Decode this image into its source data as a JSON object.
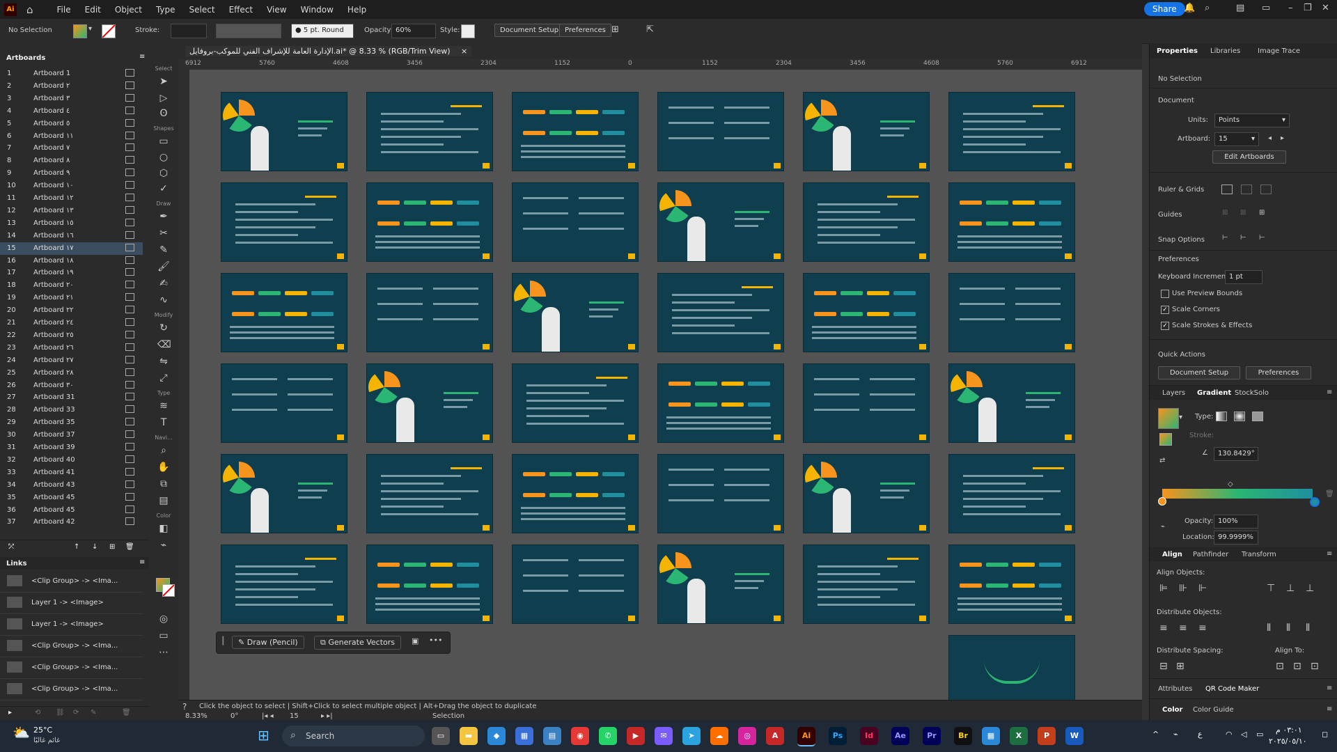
{
  "app": {
    "logo": "Ai",
    "menu": [
      "File",
      "Edit",
      "Object",
      "Type",
      "Select",
      "Effect",
      "View",
      "Window",
      "Help"
    ],
    "share_label": "Share"
  },
  "control_bar": {
    "selection": "No Selection",
    "stroke_label": "Stroke:",
    "brush": "5 pt. Round",
    "opacity_label": "Opacity:",
    "opacity_value": "60%",
    "style_label": "Style:",
    "document_setup": "Document Setup",
    "preferences": "Preferences"
  },
  "document_tab": {
    "title": "الإدارة العامة للإشراف الفني للموكب-بروفايل.ai* @ 8.33 % (RGB/Trim View)",
    "close": "×"
  },
  "ruler": [
    "6912",
    "5760",
    "4608",
    "3456",
    "2304",
    "1152",
    "0",
    "1152",
    "2304",
    "3456",
    "4608",
    "5760",
    "6912"
  ],
  "artboards_panel": {
    "title": "Artboards",
    "items": [
      {
        "num": "1",
        "name": "Artboard 1"
      },
      {
        "num": "2",
        "name": "Artboard ٢"
      },
      {
        "num": "3",
        "name": "Artboard ٣"
      },
      {
        "num": "4",
        "name": "Artboard ٤"
      },
      {
        "num": "5",
        "name": "Artboard ٥"
      },
      {
        "num": "6",
        "name": "Artboard ١١"
      },
      {
        "num": "7",
        "name": "Artboard ٧"
      },
      {
        "num": "8",
        "name": "Artboard ٨"
      },
      {
        "num": "9",
        "name": "Artboard ٩"
      },
      {
        "num": "10",
        "name": "Artboard ١٠"
      },
      {
        "num": "11",
        "name": "Artboard ١٢"
      },
      {
        "num": "12",
        "name": "Artboard ١٣"
      },
      {
        "num": "13",
        "name": "Artboard ١٥"
      },
      {
        "num": "14",
        "name": "Artboard ١٦"
      },
      {
        "num": "15",
        "name": "Artboard ١٧"
      },
      {
        "num": "16",
        "name": "Artboard ١٨"
      },
      {
        "num": "17",
        "name": "Artboard ١٩"
      },
      {
        "num": "18",
        "name": "Artboard ٢٠"
      },
      {
        "num": "19",
        "name": "Artboard ٢١"
      },
      {
        "num": "20",
        "name": "Artboard ٢٢"
      },
      {
        "num": "21",
        "name": "Artboard ٢٤"
      },
      {
        "num": "22",
        "name": "Artboard ٢٥"
      },
      {
        "num": "23",
        "name": "Artboard ٢٦"
      },
      {
        "num": "24",
        "name": "Artboard ٢٧"
      },
      {
        "num": "25",
        "name": "Artboard ٢٨"
      },
      {
        "num": "26",
        "name": "Artboard ٣٠"
      },
      {
        "num": "27",
        "name": "Artboard 31"
      },
      {
        "num": "28",
        "name": "Artboard 33"
      },
      {
        "num": "29",
        "name": "Artboard 35"
      },
      {
        "num": "30",
        "name": "Artboard 37"
      },
      {
        "num": "31",
        "name": "Artboard 39"
      },
      {
        "num": "32",
        "name": "Artboard 40"
      },
      {
        "num": "33",
        "name": "Artboard 41"
      },
      {
        "num": "34",
        "name": "Artboard 43"
      },
      {
        "num": "35",
        "name": "Artboard 45"
      },
      {
        "num": "36",
        "name": "Artboard 45"
      },
      {
        "num": "37",
        "name": "Artboard 42"
      }
    ],
    "selected_index": 14
  },
  "links_panel": {
    "title": "Links",
    "items": [
      "<Clip Group> -> <Ima...",
      "Layer 1 -> <Image>",
      "Layer 1 -> <Image>",
      "<Clip Group> -> <Ima...",
      "<Clip Group> -> <Ima...",
      "<Clip Group> -> <Ima..."
    ]
  },
  "toolbar": {
    "sections": [
      "Select",
      "Shapes",
      "Draw",
      "Modify",
      "Type",
      "Navi...",
      "Color"
    ]
  },
  "context_bar": {
    "draw_label": "Draw (Pencil)",
    "generate_label": "Generate Vectors"
  },
  "status_bar": {
    "hint": "Click the object to select  |  Shift+Click to select multiple object  |  Alt+Drag the object to duplicate",
    "zoom": "8.33%",
    "rotation": "0°",
    "artboard": "15",
    "tool": "Selection"
  },
  "right_panel": {
    "tabs": [
      "Properties",
      "Libraries",
      "Image Trace"
    ],
    "no_selection": "No Selection",
    "document_label": "Document",
    "units_label": "Units:",
    "units_value": "Points",
    "artboard_label": "Artboard:",
    "artboard_value": "15",
    "edit_artboards": "Edit Artboards",
    "rulers_grids": "Ruler & Grids",
    "guides": "Guides",
    "snap_options": "Snap Options",
    "preferences": "Preferences",
    "keyboard_increment_label": "Keyboard Increment:",
    "keyboard_increment_value": "1 pt",
    "use_preview_bounds": "Use Preview Bounds",
    "scale_corners": "Scale Corners",
    "scale_strokes": "Scale Strokes & Effects",
    "quick_actions": "Quick Actions",
    "qa_document_setup": "Document Setup",
    "qa_preferences": "Preferences",
    "gradient_tabs": [
      "Layers",
      "Gradient",
      "StockSolo"
    ],
    "type_label": "Type:",
    "stroke_label": "Stroke:",
    "angle_value": "130.8429°",
    "opacity_label": "Opacity:",
    "opacity_value": "100%",
    "location_label": "Location:",
    "location_value": "99.9999%",
    "align_tabs": [
      "Align",
      "Pathfinder",
      "Transform"
    ],
    "align_objects": "Align Objects:",
    "distribute_objects": "Distribute Objects:",
    "distribute_spacing": "Distribute Spacing:",
    "align_to": "Align To:",
    "bottom_tabs": [
      "Attributes",
      "QR Code Maker"
    ],
    "color_tabs": [
      "Color",
      "Color Guide"
    ]
  },
  "taskbar": {
    "weather_temp": "25°C",
    "weather_desc": "غائم غالبًا",
    "search_placeholder": "Search",
    "time": "٠٣:٠١ م",
    "date": "٢٠٢٥/٠٥/١٠",
    "apps": [
      "Ps",
      "Id",
      "Ae",
      "Pr",
      "Br",
      "X",
      "P",
      "W",
      "Ai"
    ]
  },
  "colors": {
    "artboard_bg": "#0f3f4f",
    "accent_orange": "#f7941d",
    "accent_green": "#2bb673",
    "accent_teal": "#1f8fa0",
    "selection_blue": "#1473e6"
  }
}
